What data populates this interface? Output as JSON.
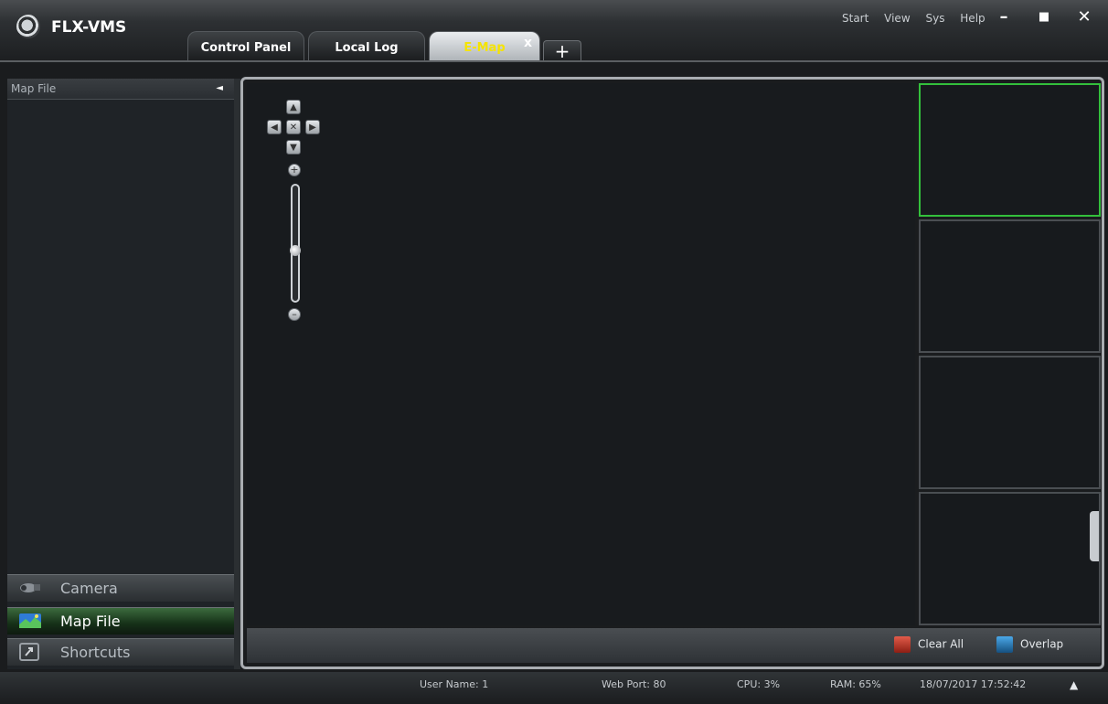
{
  "app": {
    "title": "FLX-VMS"
  },
  "tabs": [
    {
      "label": "Control Panel"
    },
    {
      "label": "Local Log"
    },
    {
      "label": "E-Map",
      "active": true,
      "close": "x"
    }
  ],
  "tab_add": "+",
  "menu": [
    "Start",
    "View",
    "Sys",
    "Help"
  ],
  "window_controls": {
    "minimize": "–",
    "maximize": "■",
    "close": "✕"
  },
  "left_panel": {
    "header": "Map File",
    "collapse_arrow": "◄",
    "nav": [
      {
        "label": "Camera",
        "icon": "camera-icon",
        "active": false
      },
      {
        "label": "Map File",
        "icon": "map-icon",
        "active": true
      },
      {
        "label": "Shortcuts",
        "icon": "shortcut-icon",
        "active": false
      }
    ]
  },
  "map_controls": {
    "up": "▲",
    "down": "▼",
    "left": "◀",
    "right": "▶",
    "center": "✕",
    "zoom_in": "+",
    "zoom_out": "–"
  },
  "map_bottom": {
    "clear_all": "Clear All",
    "overlap": "Overlap"
  },
  "status": {
    "user": "User Name: 1",
    "web_port": "Web Port: 80",
    "cpu": "CPU: 3%",
    "ram": "RAM: 65%",
    "datetime": "18/07/2017 17:52:42",
    "expand": "▲"
  },
  "colors": {
    "accent_active_tab_text": "#f5e400",
    "selected_cell_border": "#33c03c"
  }
}
